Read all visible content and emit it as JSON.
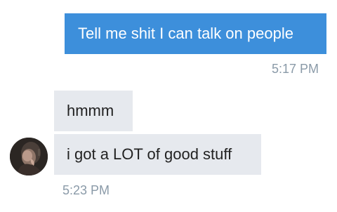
{
  "conversation": {
    "outgoing": {
      "text": "Tell me shit I can talk on people",
      "time": "5:17 PM",
      "bubble_color": "#3d8fdb"
    },
    "incoming": {
      "messages": [
        {
          "text": "hmmm"
        },
        {
          "text": "i got a LOT of good stuff"
        }
      ],
      "time": "5:23 PM",
      "bubble_color": "#e6e9ee",
      "avatar_icon": "user-photo-avatar"
    }
  }
}
